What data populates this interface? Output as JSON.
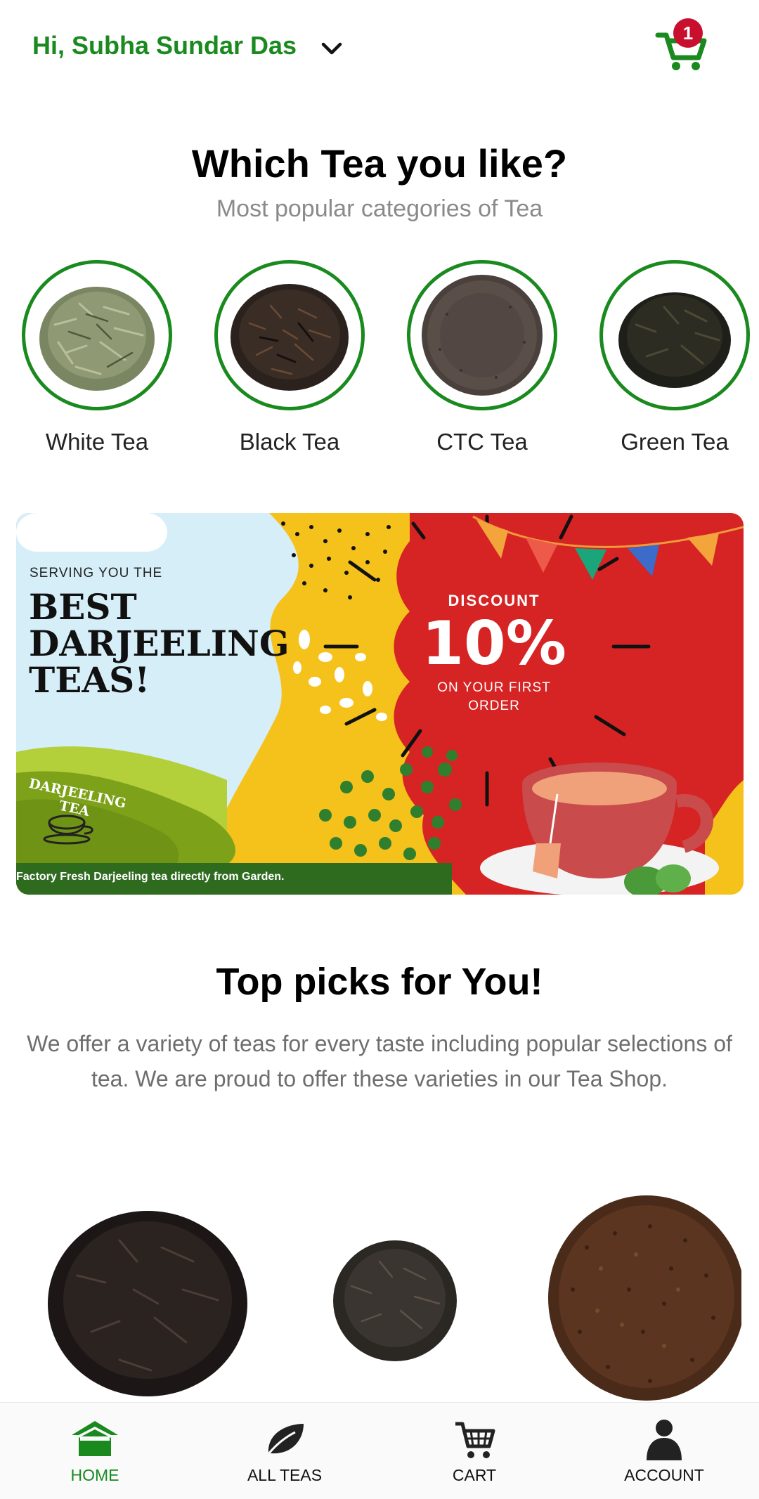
{
  "header": {
    "greeting": "Hi, Subha Sundar Das",
    "cart_badge": "1"
  },
  "categories_section": {
    "title": "Which Tea you like?",
    "subtitle": "Most popular categories of Tea",
    "items": [
      {
        "label": "White Tea"
      },
      {
        "label": "Black Tea"
      },
      {
        "label": "CTC Tea"
      },
      {
        "label": "Green Tea"
      }
    ]
  },
  "banner": {
    "serving": "SERVING YOU THE",
    "line1": "BEST",
    "line2": "DARJEELING",
    "line3": "TEAS!",
    "discount_label": "DISCOUNT",
    "discount_value": "10%",
    "offer_line1": "ON YOUR FIRST",
    "offer_line2": "ORDER",
    "logo_text": "DARJEELING TEA",
    "footer_text": "Factory Fresh Darjeeling tea directly from Garden."
  },
  "picks_section": {
    "title": "Top picks for You!",
    "description": "We offer a variety of teas for every taste including popular selections of tea. We are proud to offer these varieties in our Tea Shop."
  },
  "bottom_nav": {
    "items": [
      {
        "label": "HOME",
        "icon": "home-icon",
        "active": true
      },
      {
        "label": "ALL TEAS",
        "icon": "leaf-icon",
        "active": false
      },
      {
        "label": "CART",
        "icon": "cart-icon",
        "active": false
      },
      {
        "label": "ACCOUNT",
        "icon": "account-icon",
        "active": false
      }
    ]
  },
  "colors": {
    "brand_green": "#1a8a1f",
    "badge_red": "#c8102e",
    "banner_red": "#d62424",
    "banner_yellow": "#f4c21a"
  }
}
